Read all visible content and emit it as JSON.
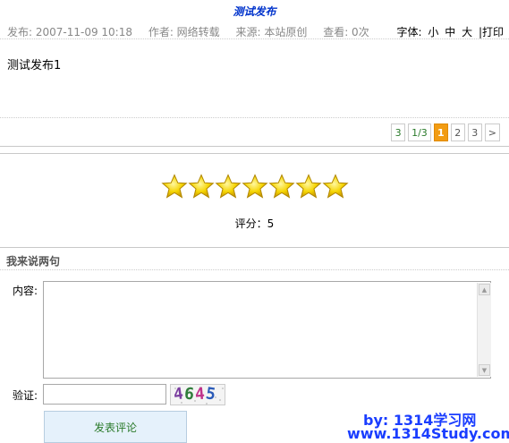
{
  "article": {
    "title": "测试发布",
    "published": "发布: 2007-11-09 10:18",
    "author": "作者: 网络转载",
    "source": "来源: 本站原创",
    "views": "查看: 0次",
    "body": "测试发布1"
  },
  "font_controls": {
    "label": "字体:",
    "small": "小",
    "medium": "中",
    "large": "大",
    "separator": "|",
    "print": "打印"
  },
  "pager": {
    "total": "3",
    "position": "1/3",
    "pages": [
      "1",
      "2",
      "3"
    ],
    "current": "1",
    "next": ">"
  },
  "rating": {
    "stars": 7,
    "star_color": "#f5d400",
    "score_text": "评分：5"
  },
  "comment": {
    "section_title": "我来说两句",
    "content_label": "内容:",
    "content_value": "",
    "verify_label": "验证:",
    "verify_value": "",
    "captcha_text": "4645",
    "submit_label": "发表评论"
  },
  "watermark": {
    "line1": "by: 1314学习网",
    "line2": "www.1314Study.com"
  }
}
